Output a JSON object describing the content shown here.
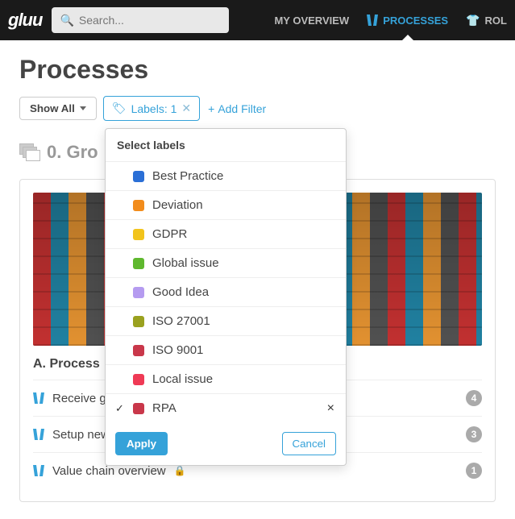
{
  "brand": "gluu",
  "search": {
    "placeholder": "Search..."
  },
  "nav": [
    {
      "label": "MY OVERVIEW",
      "active": false
    },
    {
      "label": "PROCESSES",
      "active": true
    },
    {
      "label": "ROL",
      "active": false
    }
  ],
  "page_title": "Processes",
  "filters": {
    "show_all": "Show All",
    "labels_chip": "Labels: 1",
    "add_filter": "Add Filter"
  },
  "popover": {
    "title": "Select labels",
    "apply": "Apply",
    "cancel": "Cancel",
    "labels": [
      {
        "name": "Best Practice",
        "color": "#2b6fd6",
        "selected": false
      },
      {
        "name": "Deviation",
        "color": "#f28c1c",
        "selected": false
      },
      {
        "name": "GDPR",
        "color": "#f2c41c",
        "selected": false
      },
      {
        "name": "Global issue",
        "color": "#5fb82e",
        "selected": false
      },
      {
        "name": "Good Idea",
        "color": "#b59bf0",
        "selected": false
      },
      {
        "name": "ISO 27001",
        "color": "#9aa11f",
        "selected": false
      },
      {
        "name": "ISO 9001",
        "color": "#c9374a",
        "selected": false
      },
      {
        "name": "Local issue",
        "color": "#ef3a55",
        "selected": false
      },
      {
        "name": "RPA",
        "color": "#c9374a",
        "selected": true
      }
    ]
  },
  "group": {
    "title": "0. Gro"
  },
  "section_title": "A. Process",
  "processes": [
    {
      "name": "Receive goods",
      "locked": true,
      "count": 4
    },
    {
      "name": "Setup new user for customer",
      "locked": true,
      "count": 3
    },
    {
      "name": "Value chain overview",
      "locked": true,
      "count": 1
    }
  ]
}
